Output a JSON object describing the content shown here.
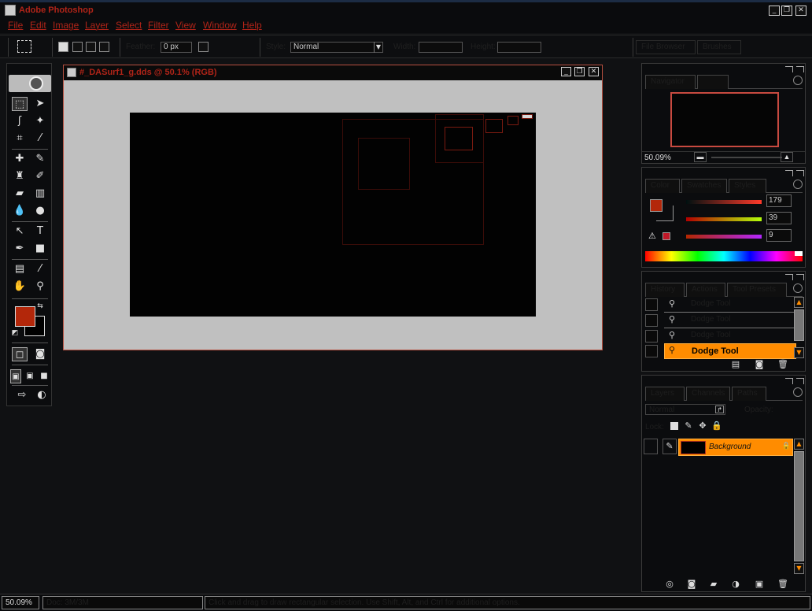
{
  "app": {
    "title": "Adobe Photoshop"
  },
  "window_buttons": {
    "minimize": "_",
    "restore": "❐",
    "close": "✕"
  },
  "menu": [
    "File",
    "Edit",
    "Image",
    "Layer",
    "Select",
    "Filter",
    "View",
    "Window",
    "Help"
  ],
  "options_bar": {
    "feather_value": "0 px",
    "style_value": "Normal",
    "ghost_feather_label": "Feather:",
    "ghost_style_label": "Style:",
    "ghost_width_label": "Width:",
    "ghost_height_label": "Height:",
    "ghost_tabs": [
      "File Browser",
      "Brushes"
    ]
  },
  "document": {
    "title": "#_DASurf1_g.dds @ 50.1% (RGB)",
    "zoom": "50.1%",
    "mode": "RGB"
  },
  "navigator": {
    "tab": "Navigator",
    "zoom_value": "50.09%"
  },
  "color_panel": {
    "tab": "Color",
    "ghost_tabs": [
      "Swatches",
      "Styles"
    ],
    "r": "179",
    "g": "39",
    "b": "9",
    "foreground_color": "#b3270a",
    "gamut_warning_icon": "⚠"
  },
  "history": {
    "tab": "History",
    "ghost_tabs": [
      "Actions",
      "Tool Presets"
    ],
    "items": [
      {
        "label": "Dodge Tool",
        "selected": false
      },
      {
        "label": "Dodge Tool",
        "selected": false
      },
      {
        "label": "Dodge Tool",
        "selected": false
      },
      {
        "label": "Dodge Tool",
        "selected": true
      }
    ]
  },
  "layers": {
    "tab": "Layers",
    "ghost_tabs": [
      "Channels",
      "Paths"
    ],
    "blend_mode": "Normal",
    "lock_label": "Lock:",
    "opacity_label": "Opacity:",
    "layer_name": "Background"
  },
  "status": {
    "zoom": "50.09%",
    "doc_info": "Doc: 3M/3M",
    "hint": "Click and drag to draw rectangular selection. Use Shift, Alt, and Ctrl for additional options."
  },
  "colors": {
    "accent_red": "#b02418",
    "highlight_orange": "#ff8c00",
    "background": "#101113"
  }
}
